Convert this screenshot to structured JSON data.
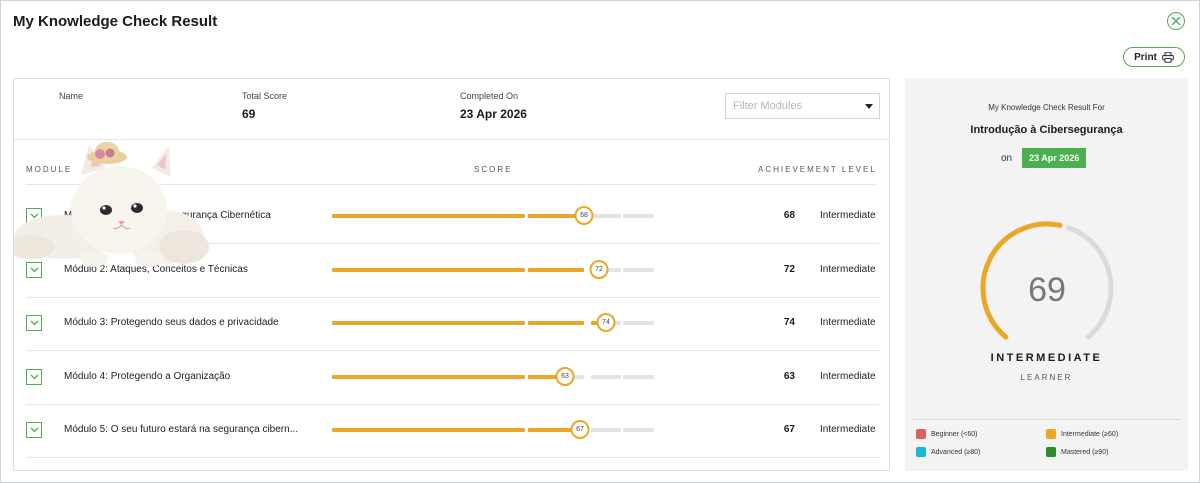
{
  "header": {
    "title": "My Knowledge Check Result",
    "print_label": "Print"
  },
  "summary": {
    "name_label": "Name",
    "total_score_label": "Total Score",
    "total_score": "69",
    "completed_label": "Completed On",
    "completed_date": "23 Apr 2026",
    "filter_placeholder": "Filter Modules"
  },
  "columns": {
    "module": "MODULE",
    "score": "SCORE",
    "achievement": "ACHIEVEMENT LEVEL"
  },
  "modules": [
    {
      "name": "Módulo 1: Introdução à Segurança Cibernética",
      "score": 68,
      "score_label": "68",
      "level": "Intermediate"
    },
    {
      "name": "Módulo 2: Ataques, Conceitos e Técnicas",
      "score": 72,
      "score_label": "72",
      "level": "Intermediate"
    },
    {
      "name": "Módulo 3: Protegendo seus dados e privacidade",
      "score": 74,
      "score_label": "74",
      "level": "Intermediate"
    },
    {
      "name": "Módulo 4: Protegendo a Organização",
      "score": 63,
      "score_label": "63",
      "level": "Intermediate"
    },
    {
      "name": "Módulo 5: O seu futuro estará na segurança cibern...",
      "score": 67,
      "score_label": "67",
      "level": "Intermediate"
    }
  ],
  "side": {
    "caption": "My Knowledge Check Result For",
    "course": "Introdução à Cibersegurança",
    "on_label": "on",
    "date": "23 Apr 2026",
    "gauge_value": 69,
    "gauge_label": "69",
    "level": "INTERMEDIATE",
    "sublevel": "LEARNER",
    "legend": [
      {
        "label": "Beginner (<60)",
        "color": "#d9625f"
      },
      {
        "label": "Intermediate (≥60)",
        "color": "#eaa727"
      },
      {
        "label": "Advanced (≥80)",
        "color": "#1ab6d9"
      },
      {
        "label": "Mastered (≥90)",
        "color": "#2e8b2e"
      }
    ]
  },
  "colors": {
    "accent": "#4caf50",
    "progress": "#eaa727",
    "track": "#e3e3e3"
  },
  "icons": {
    "close": "close-circle-icon",
    "print": "printer-icon",
    "expand": "chevron-down-icon",
    "filter": "caret-down-icon"
  }
}
